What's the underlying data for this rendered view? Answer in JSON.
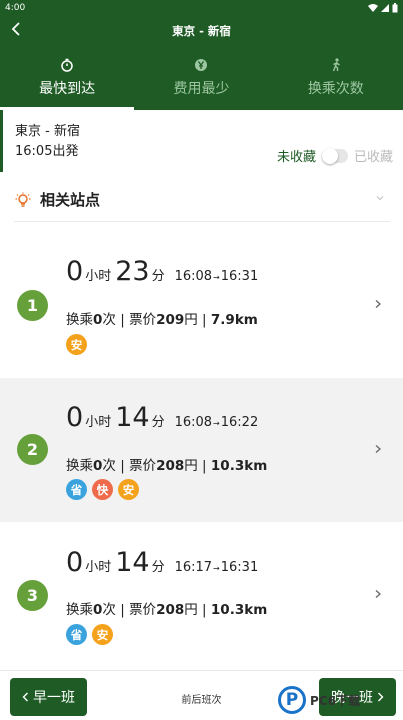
{
  "statusbar": {
    "time": "4:00"
  },
  "header": {
    "title": "東京 - 新宿"
  },
  "tabs": [
    {
      "label": "最快到达",
      "icon": "stopwatch-icon",
      "active": true
    },
    {
      "label": "费用最少",
      "icon": "yen-coin-icon",
      "active": false
    },
    {
      "label": "换乘次数",
      "icon": "walking-person-icon",
      "active": false
    }
  ],
  "route": {
    "stations": "東京 - 新宿",
    "departure": "16:05出発",
    "favorite_off_label": "未收藏",
    "favorite_on_label": "已收藏"
  },
  "related": {
    "label": "相关站点"
  },
  "results": [
    {
      "index": "1",
      "hours": "0",
      "hours_unit": "小时",
      "minutes": "23",
      "minutes_unit": "分",
      "depart": "16:08",
      "arrive": "16:31",
      "transfer_label": "换乘",
      "transfers": "0",
      "transfer_unit": "次",
      "sep1": "|",
      "fare_label": "票价",
      "fare": "209",
      "fare_unit": "円",
      "sep2": "|",
      "distance": "7.9km",
      "badges": [
        {
          "text": "安",
          "color": "#f4a21b"
        }
      ]
    },
    {
      "index": "2",
      "hours": "0",
      "hours_unit": "小时",
      "minutes": "14",
      "minutes_unit": "分",
      "depart": "16:08",
      "arrive": "16:22",
      "transfer_label": "换乘",
      "transfers": "0",
      "transfer_unit": "次",
      "sep1": "|",
      "fare_label": "票价",
      "fare": "208",
      "fare_unit": "円",
      "sep2": "|",
      "distance": "10.3km",
      "badges": [
        {
          "text": "省",
          "color": "#3aa3dd"
        },
        {
          "text": "快",
          "color": "#ef6a4a"
        },
        {
          "text": "安",
          "color": "#f4a21b"
        }
      ]
    },
    {
      "index": "3",
      "hours": "0",
      "hours_unit": "小时",
      "minutes": "14",
      "minutes_unit": "分",
      "depart": "16:17",
      "arrive": "16:31",
      "transfer_label": "换乘",
      "transfers": "0",
      "transfer_unit": "次",
      "sep1": "|",
      "fare_label": "票价",
      "fare": "208",
      "fare_unit": "円",
      "sep2": "|",
      "distance": "10.3km",
      "badges": [
        {
          "text": "省",
          "color": "#3aa3dd"
        },
        {
          "text": "安",
          "color": "#f4a21b"
        }
      ]
    }
  ],
  "bottom": {
    "prev_label": "早一班",
    "center_label": "前后班次",
    "next_label": "晚一班"
  },
  "watermark": {
    "logo": "P",
    "text": "PC6下载"
  },
  "colors": {
    "brand_green": "#1e5b25",
    "number_circle": "#66a03a",
    "alt_row": "#f2f2f2"
  }
}
